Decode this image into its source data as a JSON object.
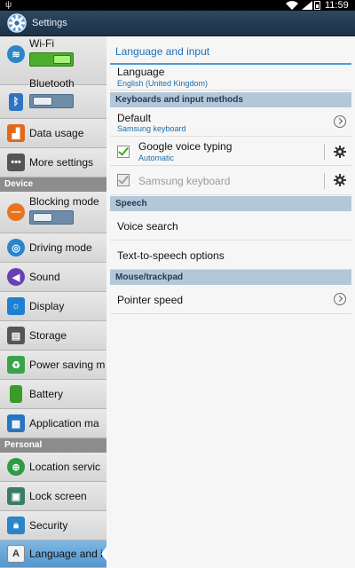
{
  "status_bar": {
    "time": "11:59"
  },
  "action_bar": {
    "title": "Settings"
  },
  "sidebar": {
    "items": [
      {
        "label": "Wi-Fi",
        "icon": "wifi-icon",
        "toggle": "on"
      },
      {
        "label": "Bluetooth",
        "icon": "bluetooth-icon",
        "toggle": "off"
      },
      {
        "label": "Data usage",
        "icon": "data-usage-icon"
      },
      {
        "label": "More settings",
        "icon": "more-settings-icon"
      },
      {
        "label": "Blocking mode",
        "icon": "blocking-mode-icon",
        "toggle": "off"
      },
      {
        "label": "Driving mode",
        "icon": "driving-mode-icon"
      },
      {
        "label": "Sound",
        "icon": "sound-icon"
      },
      {
        "label": "Display",
        "icon": "display-icon"
      },
      {
        "label": "Storage",
        "icon": "storage-icon"
      },
      {
        "label": "Power saving m",
        "icon": "power-saving-icon"
      },
      {
        "label": "Battery",
        "icon": "battery-icon"
      },
      {
        "label": "Application ma",
        "icon": "application-manager-icon"
      },
      {
        "label": "Location servic",
        "icon": "location-icon"
      },
      {
        "label": "Lock screen",
        "icon": "lock-screen-icon"
      },
      {
        "label": "Security",
        "icon": "security-icon"
      },
      {
        "label": "Language and i",
        "icon": "language-icon",
        "selected": true
      }
    ],
    "headers": {
      "device": "Device",
      "personal": "Personal"
    }
  },
  "content": {
    "title": "Language and input",
    "language": {
      "label": "Language",
      "value": "English (United Kingdom)"
    },
    "sections": {
      "keyboards": "Keyboards and input methods",
      "speech": "Speech",
      "mouse": "Mouse/trackpad"
    },
    "default": {
      "label": "Default",
      "value": "Samsung keyboard"
    },
    "google_voice": {
      "label": "Google voice typing",
      "value": "Automatic",
      "checked": true
    },
    "samsung_keyboard": {
      "label": "Samsung keyboard",
      "checked": true,
      "enabled": false
    },
    "voice_search": "Voice search",
    "tts": "Text-to-speech options",
    "pointer_speed": "Pointer speed"
  },
  "colors": {
    "accent": "#1f6fb5",
    "toggle_on": "#4cae2e",
    "section_bg": "#b4c7d8",
    "selected_bg": "#6aa9dc"
  }
}
